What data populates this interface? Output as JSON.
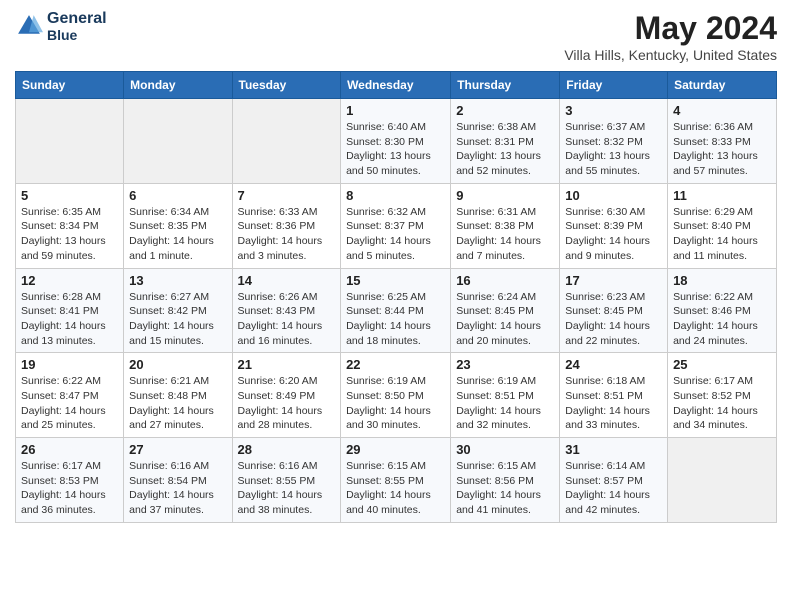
{
  "header": {
    "logo_line1": "General",
    "logo_line2": "Blue",
    "title": "May 2024",
    "subtitle": "Villa Hills, Kentucky, United States"
  },
  "days_of_week": [
    "Sunday",
    "Monday",
    "Tuesday",
    "Wednesday",
    "Thursday",
    "Friday",
    "Saturday"
  ],
  "weeks": [
    [
      {
        "day": "",
        "info": ""
      },
      {
        "day": "",
        "info": ""
      },
      {
        "day": "",
        "info": ""
      },
      {
        "day": "1",
        "info": "Sunrise: 6:40 AM\nSunset: 8:30 PM\nDaylight: 13 hours\nand 50 minutes."
      },
      {
        "day": "2",
        "info": "Sunrise: 6:38 AM\nSunset: 8:31 PM\nDaylight: 13 hours\nand 52 minutes."
      },
      {
        "day": "3",
        "info": "Sunrise: 6:37 AM\nSunset: 8:32 PM\nDaylight: 13 hours\nand 55 minutes."
      },
      {
        "day": "4",
        "info": "Sunrise: 6:36 AM\nSunset: 8:33 PM\nDaylight: 13 hours\nand 57 minutes."
      }
    ],
    [
      {
        "day": "5",
        "info": "Sunrise: 6:35 AM\nSunset: 8:34 PM\nDaylight: 13 hours\nand 59 minutes."
      },
      {
        "day": "6",
        "info": "Sunrise: 6:34 AM\nSunset: 8:35 PM\nDaylight: 14 hours\nand 1 minute."
      },
      {
        "day": "7",
        "info": "Sunrise: 6:33 AM\nSunset: 8:36 PM\nDaylight: 14 hours\nand 3 minutes."
      },
      {
        "day": "8",
        "info": "Sunrise: 6:32 AM\nSunset: 8:37 PM\nDaylight: 14 hours\nand 5 minutes."
      },
      {
        "day": "9",
        "info": "Sunrise: 6:31 AM\nSunset: 8:38 PM\nDaylight: 14 hours\nand 7 minutes."
      },
      {
        "day": "10",
        "info": "Sunrise: 6:30 AM\nSunset: 8:39 PM\nDaylight: 14 hours\nand 9 minutes."
      },
      {
        "day": "11",
        "info": "Sunrise: 6:29 AM\nSunset: 8:40 PM\nDaylight: 14 hours\nand 11 minutes."
      }
    ],
    [
      {
        "day": "12",
        "info": "Sunrise: 6:28 AM\nSunset: 8:41 PM\nDaylight: 14 hours\nand 13 minutes."
      },
      {
        "day": "13",
        "info": "Sunrise: 6:27 AM\nSunset: 8:42 PM\nDaylight: 14 hours\nand 15 minutes."
      },
      {
        "day": "14",
        "info": "Sunrise: 6:26 AM\nSunset: 8:43 PM\nDaylight: 14 hours\nand 16 minutes."
      },
      {
        "day": "15",
        "info": "Sunrise: 6:25 AM\nSunset: 8:44 PM\nDaylight: 14 hours\nand 18 minutes."
      },
      {
        "day": "16",
        "info": "Sunrise: 6:24 AM\nSunset: 8:45 PM\nDaylight: 14 hours\nand 20 minutes."
      },
      {
        "day": "17",
        "info": "Sunrise: 6:23 AM\nSunset: 8:45 PM\nDaylight: 14 hours\nand 22 minutes."
      },
      {
        "day": "18",
        "info": "Sunrise: 6:22 AM\nSunset: 8:46 PM\nDaylight: 14 hours\nand 24 minutes."
      }
    ],
    [
      {
        "day": "19",
        "info": "Sunrise: 6:22 AM\nSunset: 8:47 PM\nDaylight: 14 hours\nand 25 minutes."
      },
      {
        "day": "20",
        "info": "Sunrise: 6:21 AM\nSunset: 8:48 PM\nDaylight: 14 hours\nand 27 minutes."
      },
      {
        "day": "21",
        "info": "Sunrise: 6:20 AM\nSunset: 8:49 PM\nDaylight: 14 hours\nand 28 minutes."
      },
      {
        "day": "22",
        "info": "Sunrise: 6:19 AM\nSunset: 8:50 PM\nDaylight: 14 hours\nand 30 minutes."
      },
      {
        "day": "23",
        "info": "Sunrise: 6:19 AM\nSunset: 8:51 PM\nDaylight: 14 hours\nand 32 minutes."
      },
      {
        "day": "24",
        "info": "Sunrise: 6:18 AM\nSunset: 8:51 PM\nDaylight: 14 hours\nand 33 minutes."
      },
      {
        "day": "25",
        "info": "Sunrise: 6:17 AM\nSunset: 8:52 PM\nDaylight: 14 hours\nand 34 minutes."
      }
    ],
    [
      {
        "day": "26",
        "info": "Sunrise: 6:17 AM\nSunset: 8:53 PM\nDaylight: 14 hours\nand 36 minutes."
      },
      {
        "day": "27",
        "info": "Sunrise: 6:16 AM\nSunset: 8:54 PM\nDaylight: 14 hours\nand 37 minutes."
      },
      {
        "day": "28",
        "info": "Sunrise: 6:16 AM\nSunset: 8:55 PM\nDaylight: 14 hours\nand 38 minutes."
      },
      {
        "day": "29",
        "info": "Sunrise: 6:15 AM\nSunset: 8:55 PM\nDaylight: 14 hours\nand 40 minutes."
      },
      {
        "day": "30",
        "info": "Sunrise: 6:15 AM\nSunset: 8:56 PM\nDaylight: 14 hours\nand 41 minutes."
      },
      {
        "day": "31",
        "info": "Sunrise: 6:14 AM\nSunset: 8:57 PM\nDaylight: 14 hours\nand 42 minutes."
      },
      {
        "day": "",
        "info": ""
      }
    ]
  ]
}
